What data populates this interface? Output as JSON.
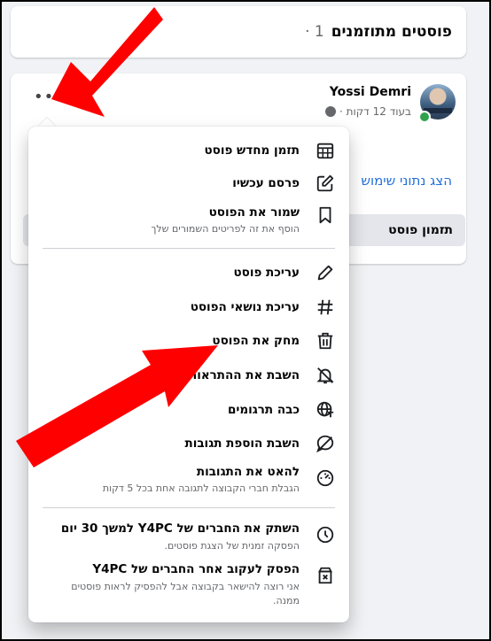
{
  "header": {
    "title": "פוסטים מתוזמנים",
    "count": "1 ·"
  },
  "post": {
    "author": "Yossi Demri",
    "time": "בעוד 12 דקות ·",
    "more": "•••",
    "usage_link": "הצג נתוני שימוש",
    "schedule_button": "תזמון פוסט"
  },
  "menu": {
    "items": [
      {
        "label": "תזמן מחדש פוסט",
        "sub": "",
        "icon": "calendar-icon"
      },
      {
        "label": "פרסם עכשיו",
        "sub": "",
        "icon": "edit-square-icon"
      },
      {
        "label": "שמור את הפוסט",
        "sub": "הוסף את זה לפריטים השמורים שלך",
        "icon": "bookmark-icon"
      },
      {
        "label": "עריכת פוסט",
        "sub": "",
        "icon": "pencil-icon"
      },
      {
        "label": "עריכת נושאי הפוסט",
        "sub": "",
        "icon": "hashtag-icon"
      },
      {
        "label": "מחק את הפוסט",
        "sub": "",
        "icon": "trash-icon"
      },
      {
        "label": "השבת את ההתראות",
        "sub": "",
        "icon": "bell-off-icon"
      },
      {
        "label": "כבה תרגומים",
        "sub": "",
        "icon": "globe-translate-icon"
      },
      {
        "label": "השבת הוספת תגובות",
        "sub": "",
        "icon": "comment-off-icon"
      },
      {
        "label": "להאט את התגובות",
        "sub": "הגבלת חברי הקבוצה לתגובה אחת בכל 5 דקות",
        "icon": "speedometer-icon"
      },
      {
        "label": "השתק את החברים של Y4PC למשך 30 יום",
        "sub": "הפסקה זמנית של הצגת פוסטים.",
        "icon": "clock-icon"
      },
      {
        "label": "הפסק לעקוב אחר החברים של Y4PC",
        "sub": "אני רוצה להישאר בקבוצה אבל להפסיק לראות פוסטים",
        "sub2": "ממנה.",
        "icon": "unfollow-box-icon"
      }
    ]
  },
  "colors": {
    "link": "#216fdb",
    "arrow": "#ff0000",
    "online": "#31a24c"
  }
}
